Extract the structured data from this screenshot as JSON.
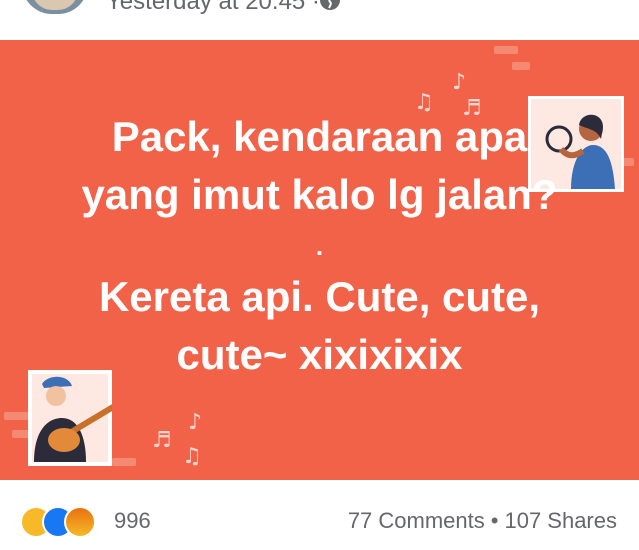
{
  "post": {
    "timestamp": "Yesterday at 20.45 ·",
    "privacy_icon": "globe-icon",
    "text_lines": [
      "Pack, kendaraan apa",
      "yang imut kalo lg jalan?",
      ".",
      "Kereta api. Cute, cute,",
      "cute~ xixixixix"
    ],
    "background_color": "#f26249",
    "text_color": "#ffffff"
  },
  "reactions": {
    "icons": [
      "haha-icon",
      "like-icon",
      "angry-icon"
    ],
    "count": "996"
  },
  "stats": {
    "comments": "77 Comments",
    "separator": "•",
    "shares": "107 Shares"
  }
}
